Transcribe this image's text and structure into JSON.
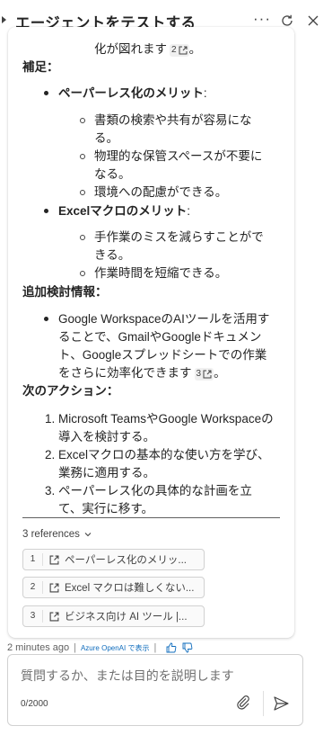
{
  "header": {
    "title": "エージェントをテストする",
    "more_label": "···"
  },
  "message": {
    "top_line": "化が図れます",
    "top_line_ref": "2",
    "top_line_end": "。",
    "supplement_heading": "補足：",
    "paperless_title": "ペーパーレス化のメリット",
    "paperless_colon": ":",
    "paperless_items": [
      [
        "書類の検索や共有が容易にな",
        "る。"
      ],
      [
        "物理的な保管スペースが不要に",
        "なる。"
      ],
      [
        "環境への配慮ができる。"
      ]
    ],
    "excel_title": "Excelマクロのメリット",
    "excel_colon": ":",
    "excel_items": [
      [
        "手作業のミスを減らすことがで",
        "きる。"
      ],
      [
        "作業時間を短縮できる。"
      ]
    ],
    "additional_heading": "追加検討情報：",
    "additional_lines": [
      "Google WorkspaceのAIツールを活用す",
      "ることで、GmailやGoogleドキュメン",
      "ト、Googleスプレッドシートでの作業",
      "をさらに効率化できます"
    ],
    "additional_ref": "3",
    "additional_end": "。",
    "next_heading": "次のアクション：",
    "actions": [
      {
        "num": "1.",
        "lines": [
          "Microsoft TeamsやGoogle Workspaceの",
          "導入を検討する。"
        ]
      },
      {
        "num": "2.",
        "lines": [
          "Excelマクロの基本的な使い方を学び、",
          "業務に適用する。"
        ]
      },
      {
        "num": "3.",
        "lines": [
          "ペーパーレス化の具体的な計画を立",
          "て、実行に移す。"
        ]
      }
    ]
  },
  "references": {
    "toggle_label": "3 references",
    "items": [
      {
        "num": "1",
        "label": "ペーパーレス化のメリッ..."
      },
      {
        "num": "2",
        "label": "Excel マクロは難しくない..."
      },
      {
        "num": "3",
        "label": "ビジネス向け AI ツール |..."
      }
    ]
  },
  "meta": {
    "time": "2 minutes ago",
    "separator": "|",
    "source": "Azure OpenAI で表示"
  },
  "input": {
    "placeholder": "質問するか、または目的を説明します",
    "counter": "0/2000"
  }
}
